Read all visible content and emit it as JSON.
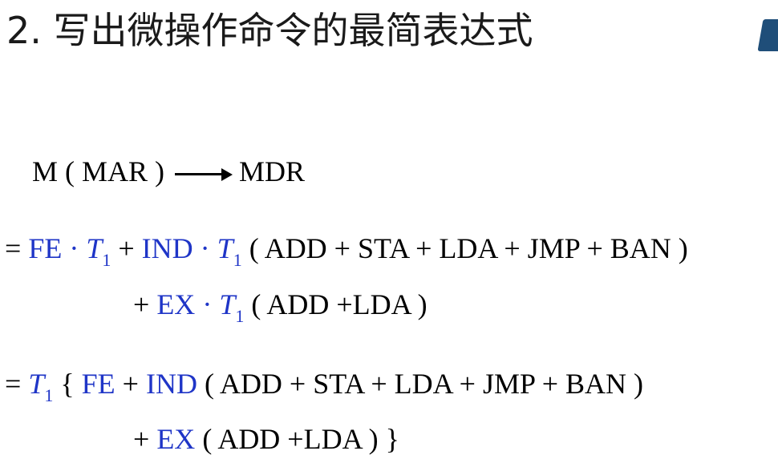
{
  "title": "2. 写出微操作命令的最简表达式",
  "colors": {
    "accent": "#1f35c7",
    "text": "#000000",
    "corner_mark": "#1f4e79"
  },
  "formula": {
    "line1": {
      "left": "M ( MAR )",
      "right": "MDR"
    },
    "line2": {
      "eq": "= ",
      "fe": "FE",
      "dot1": " ·",
      "t": "T",
      "sub": "1",
      "plus1": " + ",
      "ind": "IND",
      "dot2": " ·",
      "t2": "T",
      "sub2": "1",
      "rest": " ( ADD + STA + LDA + JMP + BAN )"
    },
    "line3": {
      "plus": "+ ",
      "ex": "EX",
      "dot": " ·",
      "t": "T",
      "sub": "1",
      "rest": " ( ADD +LDA )"
    },
    "line4": {
      "eq": "= ",
      "t": "T",
      "sub": "1",
      "brace": "{ ",
      "fe": "FE",
      "plus1": " + ",
      "ind": "IND",
      "rest": " ( ADD + STA + LDA + JMP + BAN )"
    },
    "line5": {
      "plus": "+ ",
      "ex": "EX",
      "rest": " ( ADD +LDA ) }"
    }
  }
}
